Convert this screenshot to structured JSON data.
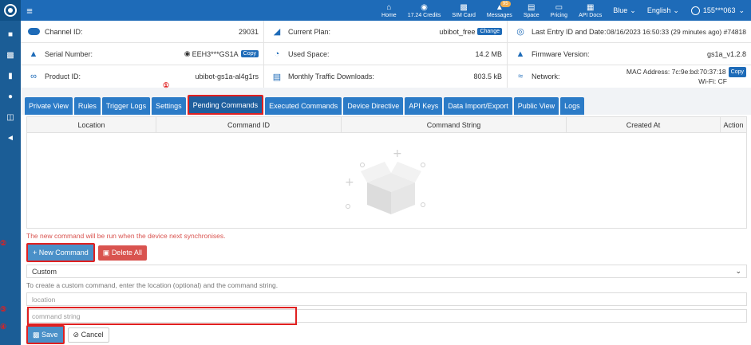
{
  "topbar": {
    "items": [
      {
        "label": "Home",
        "icon": "home-icon"
      },
      {
        "label": "17.24 Credits",
        "icon": "credits-icon"
      },
      {
        "label": "SIM Card",
        "icon": "sim-card-icon"
      },
      {
        "label": "Messages",
        "icon": "bell-icon",
        "badge": "95"
      },
      {
        "label": "Space",
        "icon": "space-icon"
      },
      {
        "label": "Pricing",
        "icon": "pricing-icon"
      },
      {
        "label": "API Docs",
        "icon": "api-docs-icon"
      }
    ],
    "theme": "Blue",
    "language": "English",
    "user": "155***063"
  },
  "info": {
    "channel_id_label": "Channel ID:",
    "channel_id": "29031",
    "current_plan_label": "Current Plan:",
    "current_plan": "ubibot_free",
    "change_label": "Change",
    "last_entry_label": "Last Entry ID and Date:",
    "last_entry": "08/16/2023 16:50:33 (29 minutes ago) #74818",
    "serial_label": "Serial Number:",
    "serial": "EEH3***GS1A",
    "copy_label": "Copy",
    "used_space_label": "Used Space:",
    "used_space": "14.2 MB",
    "firmware_label": "Firmware Version:",
    "firmware": "gs1a_v1.2.8",
    "product_label": "Product ID:",
    "product": "ubibot-gs1a-al4g1rs",
    "traffic_label": "Monthly Traffic Downloads:",
    "traffic": "803.5 kB",
    "network_label": "Network:",
    "mac": "MAC Address: 7c:9e:bd:70:37:18",
    "wifi": "Wi-Fi: CF"
  },
  "tabs": [
    "Private View",
    "Rules",
    "Trigger Logs",
    "Settings",
    "Pending Commands",
    "Executed Commands",
    "Device Directive",
    "API Keys",
    "Data Import/Export",
    "Public View",
    "Logs"
  ],
  "active_tab": "Pending Commands",
  "table": {
    "columns": [
      "Location",
      "Command ID",
      "Command String",
      "Created At",
      "Action"
    ]
  },
  "note": "The new command will be run when the device next synchronises.",
  "buttons": {
    "new_command": "New Command",
    "delete_all": "Delete All",
    "save": "Save",
    "cancel": "Cancel"
  },
  "form": {
    "select_value": "Custom",
    "hint": "To create a custom command, enter the location (optional) and the command string.",
    "location_placeholder": "location",
    "command_placeholder": "command string"
  },
  "markers": [
    "①",
    "②",
    "③",
    "④"
  ],
  "colors": {
    "topbar": "#1e6bb8",
    "rail": "#1b5d96",
    "tab": "#2b7bc7",
    "active_tab": "#1e5f9e",
    "highlight": "#e02020",
    "danger": "#d9534f"
  }
}
